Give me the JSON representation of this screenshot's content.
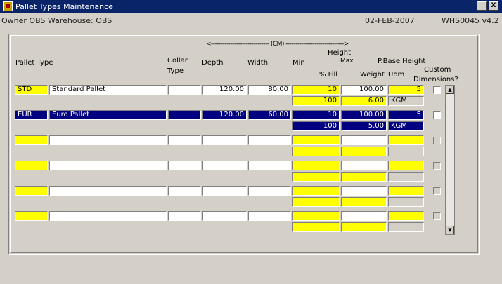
{
  "window": {
    "title": "Pallet Types Maintenance",
    "minimize": "_",
    "close": "X"
  },
  "header": {
    "owner": "Owner  OBS   Warehouse: OBS",
    "date": "02-FEB-2007",
    "screen_id": "WHS0045  v4.2"
  },
  "columns": {
    "cm_banner": "<------------------------------ (CM) ------------------------------>",
    "pallet_type": "Pallet Type",
    "collar_type_1": "Collar",
    "collar_type_2": "Type",
    "depth": "Depth",
    "width": "Width",
    "height": "Height",
    "min": "Min",
    "max": "Max",
    "fill": "% Fill",
    "weight": "Weight",
    "pbase_height": "P.Base Height",
    "uom": "Uom",
    "custom_dimensions_1": "Custom",
    "custom_dimensions_2": "Dimensions?"
  },
  "records": [
    {
      "code": "STD",
      "name": "Standard Pallet",
      "collar": "",
      "depth": "120.00",
      "width": "80.00",
      "min": "10",
      "max": "100.00",
      "fill": "100",
      "weight": "6.00",
      "pbase": "5",
      "uom": "KGM",
      "custom": false,
      "selected": false
    },
    {
      "code": "EUR",
      "name": "Euro Pallet",
      "collar": "",
      "depth": "120.00",
      "width": "60.00",
      "min": "10",
      "max": "100.00",
      "fill": "100",
      "weight": "5.00",
      "pbase": "5",
      "uom": "KGM",
      "custom": false,
      "selected": true
    },
    {
      "code": "",
      "name": "",
      "collar": "",
      "depth": "",
      "width": "",
      "min": "",
      "max": "",
      "fill": "",
      "weight": "",
      "pbase": "",
      "uom": "",
      "custom": false,
      "selected": false
    },
    {
      "code": "",
      "name": "",
      "collar": "",
      "depth": "",
      "width": "",
      "min": "",
      "max": "",
      "fill": "",
      "weight": "",
      "pbase": "",
      "uom": "",
      "custom": false,
      "selected": false
    },
    {
      "code": "",
      "name": "",
      "collar": "",
      "depth": "",
      "width": "",
      "min": "",
      "max": "",
      "fill": "",
      "weight": "",
      "pbase": "",
      "uom": "",
      "custom": false,
      "selected": false
    },
    {
      "code": "",
      "name": "",
      "collar": "",
      "depth": "",
      "width": "",
      "min": "",
      "max": "",
      "fill": "",
      "weight": "",
      "pbase": "",
      "uom": "",
      "custom": false,
      "selected": false
    }
  ],
  "scrollbar": {
    "up": "▲",
    "down": "▼"
  }
}
